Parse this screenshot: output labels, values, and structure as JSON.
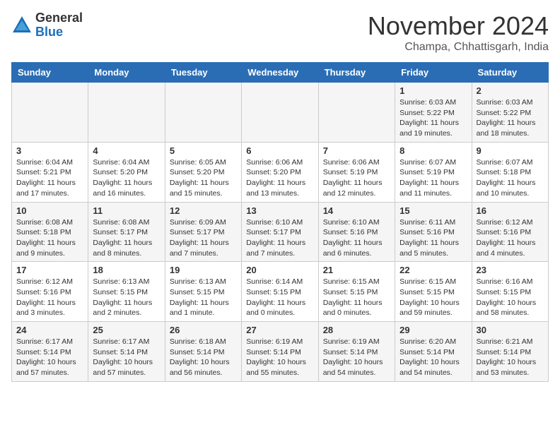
{
  "header": {
    "logo_general": "General",
    "logo_blue": "Blue",
    "month_title": "November 2024",
    "subtitle": "Champa, Chhattisgarh, India"
  },
  "weekdays": [
    "Sunday",
    "Monday",
    "Tuesday",
    "Wednesday",
    "Thursday",
    "Friday",
    "Saturday"
  ],
  "weeks": [
    [
      {
        "day": "",
        "info": ""
      },
      {
        "day": "",
        "info": ""
      },
      {
        "day": "",
        "info": ""
      },
      {
        "day": "",
        "info": ""
      },
      {
        "day": "",
        "info": ""
      },
      {
        "day": "1",
        "info": "Sunrise: 6:03 AM\nSunset: 5:22 PM\nDaylight: 11 hours and 19 minutes."
      },
      {
        "day": "2",
        "info": "Sunrise: 6:03 AM\nSunset: 5:22 PM\nDaylight: 11 hours and 18 minutes."
      }
    ],
    [
      {
        "day": "3",
        "info": "Sunrise: 6:04 AM\nSunset: 5:21 PM\nDaylight: 11 hours and 17 minutes."
      },
      {
        "day": "4",
        "info": "Sunrise: 6:04 AM\nSunset: 5:20 PM\nDaylight: 11 hours and 16 minutes."
      },
      {
        "day": "5",
        "info": "Sunrise: 6:05 AM\nSunset: 5:20 PM\nDaylight: 11 hours and 15 minutes."
      },
      {
        "day": "6",
        "info": "Sunrise: 6:06 AM\nSunset: 5:20 PM\nDaylight: 11 hours and 13 minutes."
      },
      {
        "day": "7",
        "info": "Sunrise: 6:06 AM\nSunset: 5:19 PM\nDaylight: 11 hours and 12 minutes."
      },
      {
        "day": "8",
        "info": "Sunrise: 6:07 AM\nSunset: 5:19 PM\nDaylight: 11 hours and 11 minutes."
      },
      {
        "day": "9",
        "info": "Sunrise: 6:07 AM\nSunset: 5:18 PM\nDaylight: 11 hours and 10 minutes."
      }
    ],
    [
      {
        "day": "10",
        "info": "Sunrise: 6:08 AM\nSunset: 5:18 PM\nDaylight: 11 hours and 9 minutes."
      },
      {
        "day": "11",
        "info": "Sunrise: 6:08 AM\nSunset: 5:17 PM\nDaylight: 11 hours and 8 minutes."
      },
      {
        "day": "12",
        "info": "Sunrise: 6:09 AM\nSunset: 5:17 PM\nDaylight: 11 hours and 7 minutes."
      },
      {
        "day": "13",
        "info": "Sunrise: 6:10 AM\nSunset: 5:17 PM\nDaylight: 11 hours and 7 minutes."
      },
      {
        "day": "14",
        "info": "Sunrise: 6:10 AM\nSunset: 5:16 PM\nDaylight: 11 hours and 6 minutes."
      },
      {
        "day": "15",
        "info": "Sunrise: 6:11 AM\nSunset: 5:16 PM\nDaylight: 11 hours and 5 minutes."
      },
      {
        "day": "16",
        "info": "Sunrise: 6:12 AM\nSunset: 5:16 PM\nDaylight: 11 hours and 4 minutes."
      }
    ],
    [
      {
        "day": "17",
        "info": "Sunrise: 6:12 AM\nSunset: 5:16 PM\nDaylight: 11 hours and 3 minutes."
      },
      {
        "day": "18",
        "info": "Sunrise: 6:13 AM\nSunset: 5:15 PM\nDaylight: 11 hours and 2 minutes."
      },
      {
        "day": "19",
        "info": "Sunrise: 6:13 AM\nSunset: 5:15 PM\nDaylight: 11 hours and 1 minute."
      },
      {
        "day": "20",
        "info": "Sunrise: 6:14 AM\nSunset: 5:15 PM\nDaylight: 11 hours and 0 minutes."
      },
      {
        "day": "21",
        "info": "Sunrise: 6:15 AM\nSunset: 5:15 PM\nDaylight: 11 hours and 0 minutes."
      },
      {
        "day": "22",
        "info": "Sunrise: 6:15 AM\nSunset: 5:15 PM\nDaylight: 10 hours and 59 minutes."
      },
      {
        "day": "23",
        "info": "Sunrise: 6:16 AM\nSunset: 5:15 PM\nDaylight: 10 hours and 58 minutes."
      }
    ],
    [
      {
        "day": "24",
        "info": "Sunrise: 6:17 AM\nSunset: 5:14 PM\nDaylight: 10 hours and 57 minutes."
      },
      {
        "day": "25",
        "info": "Sunrise: 6:17 AM\nSunset: 5:14 PM\nDaylight: 10 hours and 57 minutes."
      },
      {
        "day": "26",
        "info": "Sunrise: 6:18 AM\nSunset: 5:14 PM\nDaylight: 10 hours and 56 minutes."
      },
      {
        "day": "27",
        "info": "Sunrise: 6:19 AM\nSunset: 5:14 PM\nDaylight: 10 hours and 55 minutes."
      },
      {
        "day": "28",
        "info": "Sunrise: 6:19 AM\nSunset: 5:14 PM\nDaylight: 10 hours and 54 minutes."
      },
      {
        "day": "29",
        "info": "Sunrise: 6:20 AM\nSunset: 5:14 PM\nDaylight: 10 hours and 54 minutes."
      },
      {
        "day": "30",
        "info": "Sunrise: 6:21 AM\nSunset: 5:14 PM\nDaylight: 10 hours and 53 minutes."
      }
    ]
  ]
}
